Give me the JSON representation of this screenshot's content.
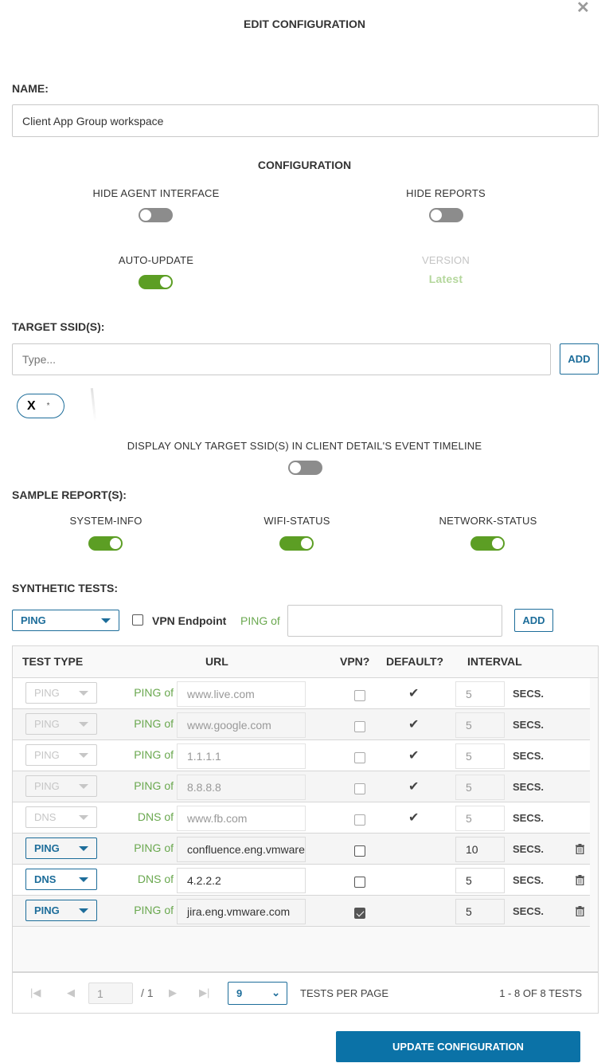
{
  "dialog": {
    "title": "EDIT CONFIGURATION",
    "close_icon": "close-icon"
  },
  "name": {
    "label": "NAME:",
    "value": "Client App Group workspace"
  },
  "configuration": {
    "heading": "CONFIGURATION",
    "hide_agent_interface": {
      "label": "HIDE AGENT INTERFACE",
      "on": false
    },
    "hide_reports": {
      "label": "HIDE REPORTS",
      "on": false
    },
    "auto_update": {
      "label": "AUTO-UPDATE",
      "on": true
    },
    "version": {
      "label": "VERSION",
      "value": "Latest"
    }
  },
  "target_ssid": {
    "label": "TARGET SSID(S):",
    "placeholder": "Type...",
    "add_label": "ADD",
    "chips": [
      {
        "remove_icon": "X",
        "text": "*"
      }
    ],
    "display_only": {
      "label": "DISPLAY ONLY TARGET SSID(S) IN CLIENT DETAIL'S EVENT TIMELINE",
      "on": false
    }
  },
  "sample_reports": {
    "label": "SAMPLE REPORT(S):",
    "items": [
      {
        "label": "SYSTEM-INFO",
        "on": true
      },
      {
        "label": "WIFI-STATUS",
        "on": true
      },
      {
        "label": "NETWORK-STATUS",
        "on": true
      }
    ]
  },
  "synthetic_tests": {
    "label": "SYNTHETIC TESTS:",
    "new_test": {
      "type": "PING",
      "vpn_label": "VPN Endpoint",
      "vpn_checked": false,
      "of_label": "PING of",
      "value": "",
      "add_label": "ADD"
    },
    "columns": [
      "TEST TYPE",
      "URL",
      "VPN?",
      "DEFAULT?",
      "INTERVAL"
    ],
    "rows": [
      {
        "type": "PING",
        "of": "PING of",
        "url": "www.live.com",
        "vpn": false,
        "default": true,
        "interval": "5",
        "unit": "SECS.",
        "editable": false
      },
      {
        "type": "PING",
        "of": "PING of",
        "url": "www.google.com",
        "vpn": false,
        "default": true,
        "interval": "5",
        "unit": "SECS.",
        "editable": false
      },
      {
        "type": "PING",
        "of": "PING of",
        "url": "1.1.1.1",
        "vpn": false,
        "default": true,
        "interval": "5",
        "unit": "SECS.",
        "editable": false
      },
      {
        "type": "PING",
        "of": "PING of",
        "url": "8.8.8.8",
        "vpn": false,
        "default": true,
        "interval": "5",
        "unit": "SECS.",
        "editable": false
      },
      {
        "type": "DNS",
        "of": "DNS of",
        "url": "www.fb.com",
        "vpn": false,
        "default": true,
        "interval": "5",
        "unit": "SECS.",
        "editable": false
      },
      {
        "type": "PING",
        "of": "PING of",
        "url": "confluence.eng.vmware.",
        "vpn": false,
        "default": false,
        "interval": "10",
        "unit": "SECS.",
        "editable": true
      },
      {
        "type": "DNS",
        "of": "DNS of",
        "url": "4.2.2.2",
        "vpn": false,
        "default": false,
        "interval": "5",
        "unit": "SECS.",
        "editable": true
      },
      {
        "type": "PING",
        "of": "PING of",
        "url": "jira.eng.vmware.com",
        "vpn": true,
        "default": false,
        "interval": "5",
        "unit": "SECS.",
        "editable": true
      }
    ],
    "pagination": {
      "page": "1",
      "total_pages": "/ 1",
      "per_page": "9",
      "per_page_label": "TESTS PER PAGE",
      "summary": "1 - 8 OF 8 TESTS"
    }
  },
  "footer": {
    "update_label": "UPDATE CONFIGURATION"
  },
  "colors": {
    "accent": "#0b72a7",
    "toggle_on": "#5c9e24",
    "toggle_off": "#8c8c8c",
    "of_label": "#6aa84f"
  }
}
